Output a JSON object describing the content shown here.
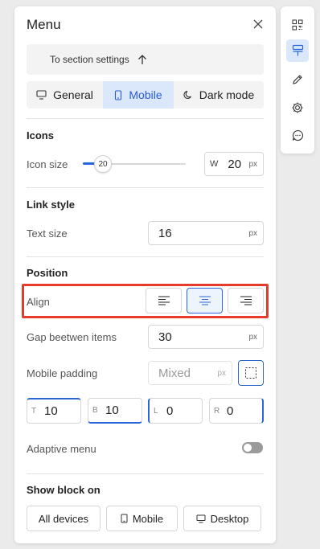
{
  "panel": {
    "title": "Menu",
    "back_label": "To section settings"
  },
  "tabs": [
    {
      "label": "General",
      "icon": "monitor-icon",
      "active": false
    },
    {
      "label": "Mobile",
      "icon": "smartphone-icon",
      "active": true
    },
    {
      "label": "Dark mode",
      "icon": "moon-icon",
      "active": false
    }
  ],
  "icons_section": {
    "title": "Icons",
    "size_label": "Icon size",
    "slider_value": "20",
    "width_prefix": "W",
    "width_value": "20",
    "unit": "px"
  },
  "link_style": {
    "title": "Link style",
    "text_size_label": "Text size",
    "text_size_value": "16",
    "unit": "px"
  },
  "position": {
    "title": "Position",
    "align_label": "Align",
    "align_options": [
      "left",
      "center",
      "right"
    ],
    "align_selected": "center",
    "gap_label": "Gap beetwen items",
    "gap_value": "30",
    "unit": "px",
    "padding_label": "Mobile padding",
    "padding_placeholder": "Mixed",
    "padding_top_prefix": "T",
    "padding_top": "10",
    "padding_bottom_prefix": "B",
    "padding_bottom": "10",
    "padding_left_prefix": "L",
    "padding_left": "0",
    "padding_right_prefix": "R",
    "padding_right": "0",
    "adaptive_label": "Adaptive menu",
    "adaptive_on": false
  },
  "show_block": {
    "title": "Show block on",
    "options": [
      "All devices",
      "Mobile",
      "Desktop"
    ]
  },
  "toolbar": {
    "tools": [
      "qr-code-icon",
      "paint-roller-icon",
      "pencil-icon",
      "gear-icon",
      "chat-icon"
    ],
    "active": "paint-roller-icon"
  },
  "colors": {
    "accent": "#2a66d9",
    "active_bg": "#dbe8fb",
    "highlight": "#e53a2c"
  }
}
